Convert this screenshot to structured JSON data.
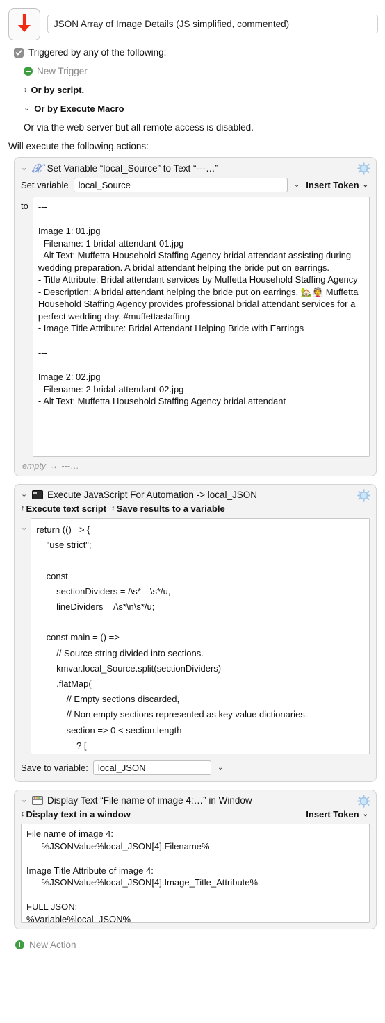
{
  "macro": {
    "icon": "down-arrow-icon",
    "title": "JSON Array of Image Details (JS simplified, commented)"
  },
  "triggers": {
    "checkbox_label": "Triggered by any of the following:",
    "new_trigger_label": "New Trigger",
    "or_by_script": "Or by script.",
    "or_by_execute_macro": "Or by Execute Macro",
    "web_server_note": "Or via the web server but all remote access is disabled."
  },
  "will_execute_label": "Will execute the following actions:",
  "actions": [
    {
      "icon": "variable-icon",
      "title": "Set Variable “local_Source” to Text “---…”",
      "gear": "gear-icon",
      "set_variable_label": "Set variable",
      "variable_value": "local_Source",
      "insert_token_label": "Insert Token",
      "to_label": "to",
      "text_value": "---\n\nImage 1: 01.jpg\n- Filename: 1 bridal-attendant-01.jpg\n- Alt Text: Muffetta Household Staffing Agency bridal attendant assisting during wedding preparation. A bridal attendant helping the bride put on earrings.\n- Title Attribute: Bridal attendant services by Muffetta Household Staffing Agency\n- Description: A bridal attendant helping the bride put on earrings. 🏡👰 Muffetta Household Staffing Agency provides professional bridal attendant services for a perfect wedding day. #muffettastaffing\n- Image Title Attribute: Bridal Attendant Helping Bride with Earrings\n\n---\n\nImage 2: 02.jpg\n- Filename: 2 bridal-attendant-02.jpg\n- Alt Text: Muffetta Household Staffing Agency bridal attendant",
      "footer_from": "empty",
      "footer_arrow": "→",
      "footer_to": "---…"
    },
    {
      "icon": "terminal-icon",
      "title": "Execute JavaScript For Automation -> local_JSON",
      "gear": "gear-icon",
      "execute_mode_label": "Execute text script",
      "save_results_label": "Save results to a variable",
      "script_value": "return (() => {\n    \"use strict\";\n\n    const\n        sectionDividers = /\\s*---\\s*/u,\n        lineDividers = /\\s*\\n\\s*/u;\n\n    const main = () =>\n        // Source string divided into sections.\n        kmvar.local_Source.split(sectionDividers)\n        .flatMap(\n            // Empty sections discarded,\n            // Non empty sections represented as key:value dictionaries.\n            section => 0 < section.length\n                ? [\n                    // Key:value Object (dictionary) of key-value pairs\n                    Object.fromEntries(\n                        // Section split into lines.\n                        section.split(lineDividers)",
      "save_to_variable_label": "Save to variable:",
      "save_to_variable_value": "local_JSON"
    },
    {
      "icon": "window-icon",
      "title": "Display Text “File name of image 4:…” in Window",
      "gear": "gear-icon",
      "display_mode_label": "Display text in a window",
      "insert_token_label": "Insert Token",
      "text_value": "File name of image 4:\n      %JSONValue%local_JSON[4].Filename%\n\nImage Title Attribute of image 4:\n      %JSONValue%local_JSON[4].Image_Title_Attribute%\n\nFULL JSON:\n%Variable%local_JSON%"
    }
  ],
  "new_action_label": "New Action",
  "colors": {
    "accent_red": "#ef2b12",
    "green": "#3f9e3f",
    "gear_blue": "#a8cdf0",
    "variable_blue": "#7f9ddb",
    "card_bg": "#f3f3f3",
    "card_border": "#d3d3d3"
  }
}
